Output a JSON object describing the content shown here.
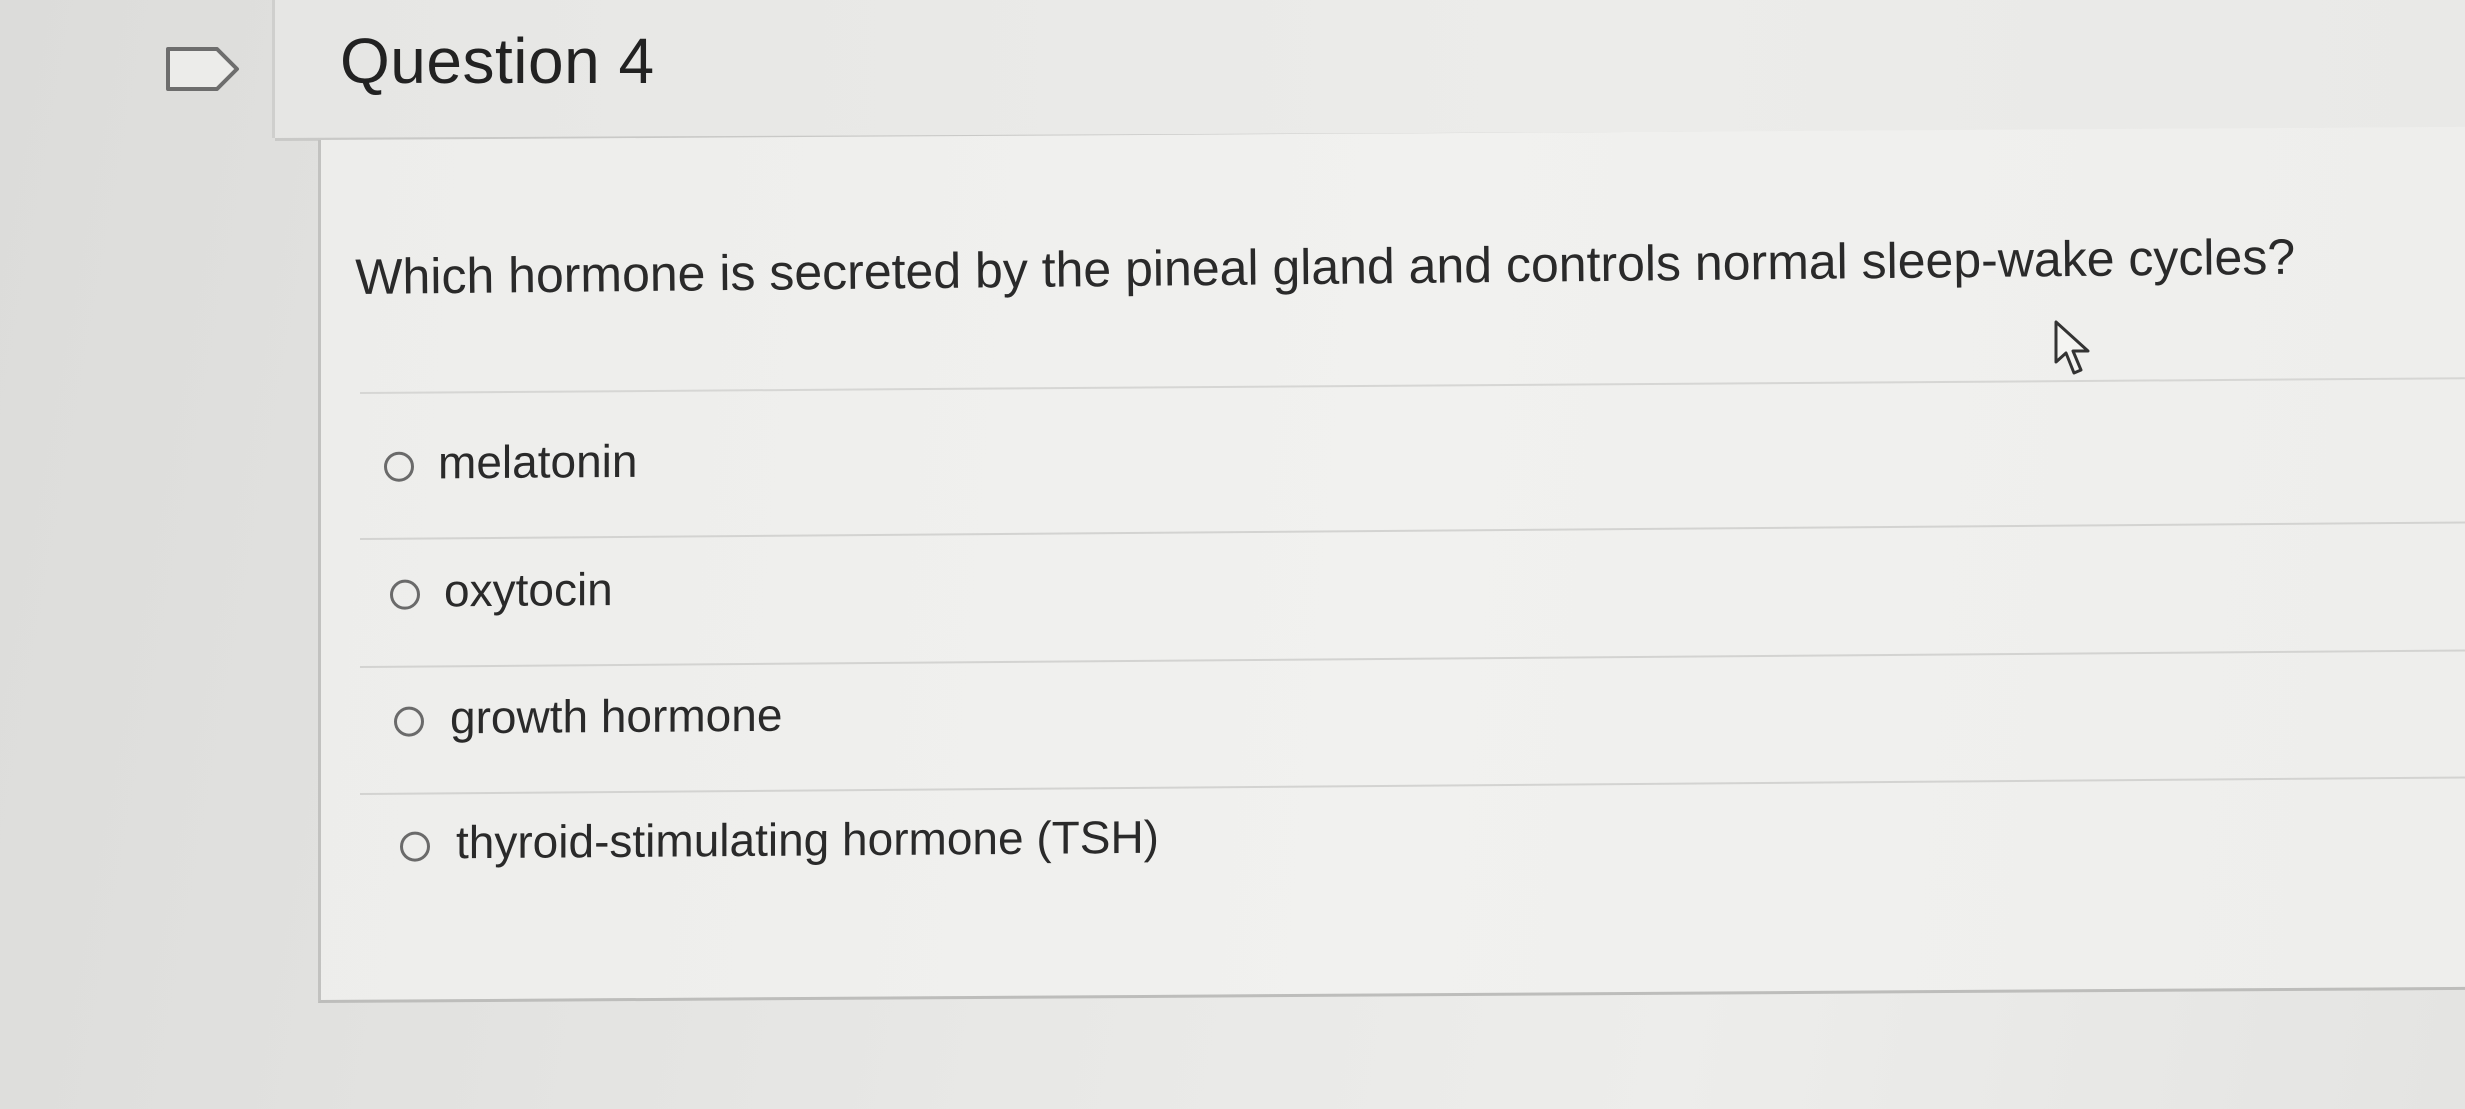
{
  "question": {
    "title": "Question 4",
    "prompt": "Which hormone is secreted by the pineal gland and controls normal sleep-wake cycles?",
    "options": [
      {
        "label": "melatonin",
        "selected": false
      },
      {
        "label": "oxytocin",
        "selected": false
      },
      {
        "label": "growth hormone",
        "selected": false
      },
      {
        "label": "thyroid-stimulating hormone (TSH)",
        "selected": false
      }
    ]
  },
  "icons": {
    "flag": "flag-icon",
    "cursor": "mouse-pointer-icon"
  },
  "colors": {
    "background": "#e3e3e1",
    "card": "#efefed",
    "text": "#2a2a2a",
    "radio_border": "#6a6a6a",
    "divider": "#d3d3d1"
  }
}
